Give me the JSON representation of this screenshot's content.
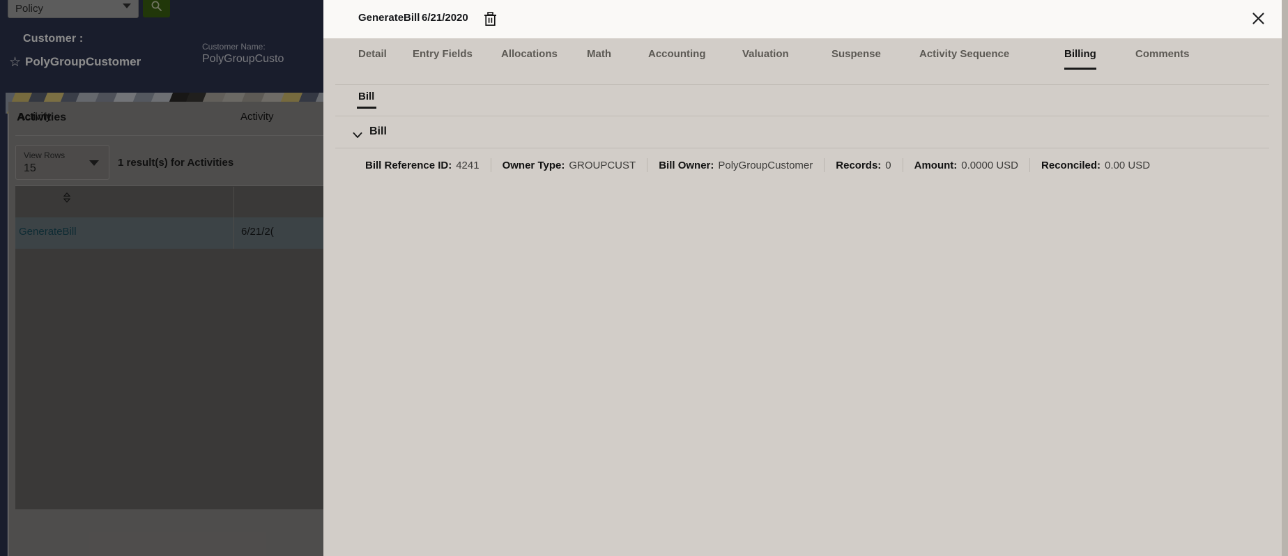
{
  "background": {
    "policy_select": {
      "label": "Policy",
      "caret_icon": "chevron-down-icon"
    },
    "search_button": {
      "icon": "search-icon",
      "color": "#3d6411"
    },
    "customer": {
      "heading": "Customer :",
      "star_icon": "star-outline-icon",
      "name": "PolyGroupCustomer",
      "meta_label": "Customer Name:",
      "meta_value": "PolyGroupCusto"
    },
    "card": {
      "title": "Activities",
      "view_rows": {
        "label": "View Rows",
        "value": "15",
        "caret_icon": "chevron-down-icon"
      },
      "results_text": "1 result(s) for Activities",
      "columns": [
        "Activity",
        "Activity"
      ],
      "sort_icon": "sort-updown-icon",
      "rows": [
        {
          "activity": "GenerateBill",
          "activity_date": "6/21/2("
        }
      ]
    }
  },
  "modal": {
    "title": "GenerateBill",
    "subtitle": "6/21/2020",
    "delete_icon": "trash-icon",
    "close_icon": "close-icon",
    "tabs": [
      {
        "label": "Detail",
        "active": false
      },
      {
        "label": "Entry Fields",
        "active": false
      },
      {
        "label": "Allocations",
        "active": false
      },
      {
        "label": "Math",
        "active": false
      },
      {
        "label": "Accounting",
        "active": false
      },
      {
        "label": "Valuation",
        "active": false
      },
      {
        "label": "Suspense",
        "active": false
      },
      {
        "label": "Activity Sequence",
        "active": false
      },
      {
        "label": "Billing",
        "active": true
      },
      {
        "label": "Comments",
        "active": false
      }
    ],
    "subtabs": [
      {
        "label": "Bill",
        "active": true
      }
    ],
    "section": {
      "title": "Bill",
      "chevron_icon": "chevron-down-icon",
      "fields": [
        {
          "key": "Bill Reference ID:",
          "value": "4241"
        },
        {
          "key": "Owner Type:",
          "value": "GROUPCUST"
        },
        {
          "key": "Bill Owner:",
          "value": "PolyGroupCustomer"
        },
        {
          "key": "Records:",
          "value": "0"
        },
        {
          "key": "Amount:",
          "value": "0.0000 USD"
        },
        {
          "key": "Reconciled:",
          "value": "0.00 USD"
        }
      ]
    }
  }
}
